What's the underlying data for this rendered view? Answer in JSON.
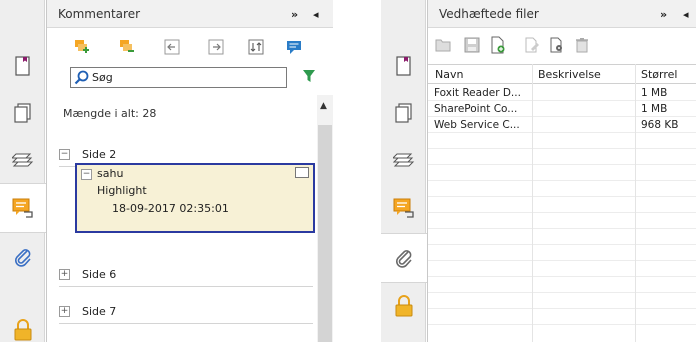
{
  "comments_panel": {
    "title": "Kommentarer",
    "controls": {
      "expand": "»",
      "collapse": "◂"
    },
    "search_placeholder": "Søg",
    "total_count": "Mængde i alt: 28",
    "groups": [
      {
        "label": "Side 2",
        "expander": "−"
      },
      {
        "label": "Side 6",
        "expander": "+"
      },
      {
        "label": "Side 7",
        "expander": "+"
      }
    ],
    "comment": {
      "author": "sahu",
      "type": "Highlight",
      "timestamp": "18-09-2017 02:35:01",
      "expander": "−"
    },
    "accent_color": "#2b3aa0",
    "highlight_color": "#f7f1d6"
  },
  "attachments_panel": {
    "title": "Vedhæftede filer",
    "controls": {
      "expand": "»",
      "collapse": "◂"
    },
    "columns": [
      "Navn",
      "Beskrivelse",
      "Størrel"
    ],
    "rows": [
      {
        "name": "Foxit Reader D...",
        "description": "",
        "size": "1 MB"
      },
      {
        "name": "SharePoint Co...",
        "description": "",
        "size": "1 MB"
      },
      {
        "name": "Web Service C...",
        "description": "",
        "size": "968 KB"
      }
    ]
  },
  "sidebar_icons": [
    "pages-icon",
    "layers-icon",
    "comments-icon",
    "attachments-icon",
    "lock-icon"
  ]
}
